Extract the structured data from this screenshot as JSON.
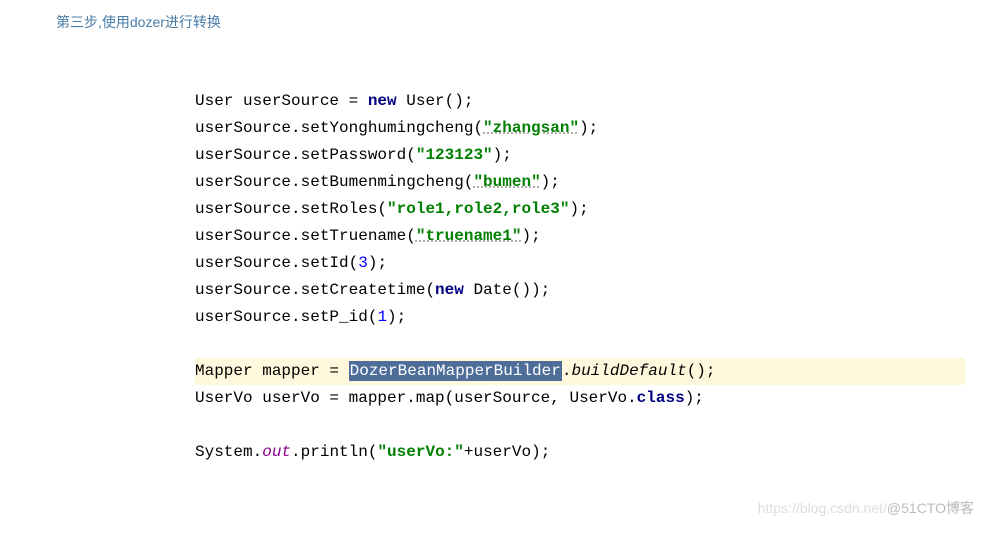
{
  "title": "第三步,使用dozer进行转换",
  "code": {
    "l1_a": "User userSource = ",
    "l1_new": "new",
    "l1_b": " User();",
    "l2_a": "userSource.setYonghumingcheng(",
    "l2_str": "\"zhangsan\"",
    "l2_b": ");",
    "l3_a": "userSource.setPassword(",
    "l3_str": "\"123123\"",
    "l3_b": ");",
    "l4_a": "userSource.setBumenmingcheng(",
    "l4_str": "\"bumen\"",
    "l4_b": ");",
    "l5_a": "userSource.setRoles(",
    "l5_str": "\"role1,role2,role3\"",
    "l5_b": ");",
    "l6_a": "userSource.setTruename(",
    "l6_str": "\"truename1\"",
    "l6_b": ");",
    "l7_a": "userSource.setId(",
    "l7_num": "3",
    "l7_b": ");",
    "l8_a": "userSource.setCreatetime(",
    "l8_new": "new",
    "l8_b": " Date());",
    "l9_a": "userSource.setP_id(",
    "l9_num": "1",
    "l9_b": ");",
    "l10_a": "Mapper mapper = ",
    "l10_sel": "DozerBeanMapperBuilder",
    "l10_b": ".",
    "l10_it": "buildDefault",
    "l10_c": "();",
    "l11_a": "UserVo userVo = mapper.map(userSource, UserVo.",
    "l11_kw": "class",
    "l11_b": ");",
    "l12_a": "System.",
    "l12_out": "out",
    "l12_b": ".println(",
    "l12_str": "\"userVo:\"",
    "l12_c": "+userVo);"
  },
  "watermark": {
    "left": "https://blog.csdn.net/",
    "right": "@51CTO博客"
  }
}
